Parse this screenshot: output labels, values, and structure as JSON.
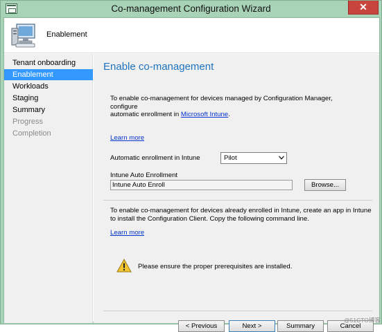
{
  "window": {
    "title": "Co-management Configuration Wizard",
    "close_glyph": "✕"
  },
  "header": {
    "title": "Enablement",
    "icon": "computer-icon"
  },
  "sidebar": {
    "items": [
      {
        "label": "Tenant onboarding",
        "state": "normal"
      },
      {
        "label": "Enablement",
        "state": "active"
      },
      {
        "label": "Workloads",
        "state": "normal"
      },
      {
        "label": "Staging",
        "state": "normal"
      },
      {
        "label": "Summary",
        "state": "normal"
      },
      {
        "label": "Progress",
        "state": "disabled"
      },
      {
        "label": "Completion",
        "state": "disabled"
      }
    ]
  },
  "main": {
    "title": "Enable co-management",
    "intro_line1": "To enable co-management for devices managed by Configuration Manager, configure",
    "intro_line2_prefix": "automatic enrollment in ",
    "intro_link": "Microsoft Intune",
    "intro_line2_suffix": ".",
    "learn_more_1": "Learn more",
    "auto_enroll_label": "Automatic enrollment in Intune",
    "auto_enroll_value": "Pilot",
    "intune_auto_label": "Intune Auto Enrollment",
    "intune_auto_value": "Intune Auto Enroll",
    "browse_label": "Browse...",
    "section2_line1": "To enable co-management for devices already enrolled in Intune, create an app in Intune",
    "section2_line2": "to install the Configuration Client. Copy the following command line.",
    "learn_more_2": "Learn more",
    "warning_text": "Please ensure the proper prerequisites are installed.",
    "warning_icon": "warning-icon"
  },
  "buttons": {
    "previous": "< Previous",
    "next": "Next >",
    "summary": "Summary",
    "cancel": "Cancel"
  },
  "watermark": "@51CTO博客",
  "colors": {
    "titlebar": "#a9d3b7",
    "accent": "#1e73be",
    "selection": "#3399ff",
    "close": "#c8453e"
  }
}
